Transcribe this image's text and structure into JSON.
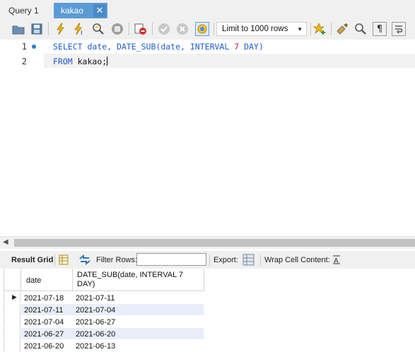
{
  "tabs": [
    {
      "label": "Query 1"
    },
    {
      "label": "kakao"
    }
  ],
  "toolbar": {
    "limit_label": "Limit to 1000 rows"
  },
  "editor": {
    "line_numbers": [
      "1",
      "2"
    ],
    "line1": {
      "t1": "SELECT",
      "t2": " date, ",
      "t3": "DATE_SUB",
      "t4": "(date, ",
      "t5": "INTERVAL",
      "t6": " ",
      "t7": "7",
      "t8": " ",
      "t9": "DAY",
      "t10": ")"
    },
    "line2": {
      "t1": "FROM",
      "t2": " kakao;"
    }
  },
  "result_toolbar": {
    "result_grid": "Result Grid",
    "filter_rows": "Filter Rows:",
    "filter_value": "",
    "export": "Export:",
    "wrap_cell": "Wrap Cell Content:"
  },
  "grid": {
    "columns": [
      "date",
      "DATE_SUB(date, INTERVAL 7 DAY)"
    ],
    "col2_line1": "DATE_SUB(date, INTERVAL 7",
    "col2_line2": "DAY)",
    "rows": [
      [
        "2021-07-18",
        "2021-07-11"
      ],
      [
        "2021-07-11",
        "2021-07-04"
      ],
      [
        "2021-07-04",
        "2021-06-27"
      ],
      [
        "2021-06-27",
        "2021-06-20"
      ],
      [
        "2021-06-20",
        "2021-06-13"
      ]
    ]
  },
  "colors": {
    "tab_active": "#5b9bd5",
    "keyword": "#1f5ccc",
    "number": "#dd1144",
    "row_alt": "#e8effa"
  }
}
